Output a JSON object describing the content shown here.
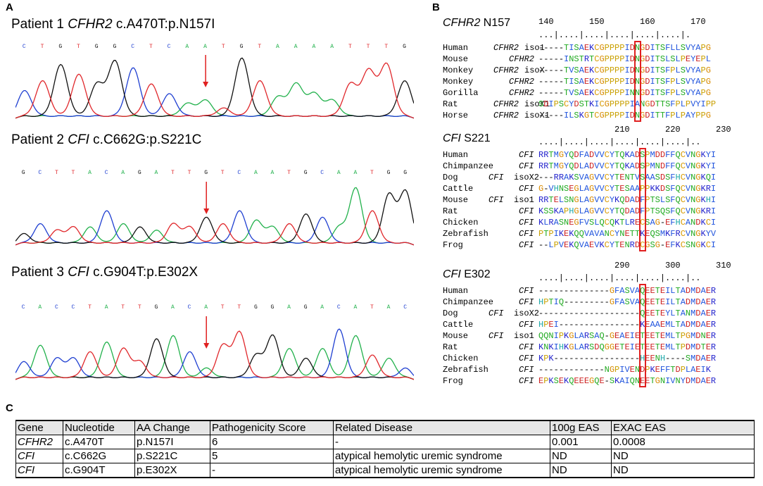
{
  "panel_a": {
    "letter": "A",
    "patients": [
      {
        "label": "Patient 1",
        "gene": "CFHR2",
        "variant": "c.A470T:p.N157I",
        "bases": [
          "C",
          "T",
          "G",
          "T",
          "G",
          "G",
          "C",
          "T",
          "C",
          "A",
          "A",
          "T",
          "G",
          "T",
          "A",
          "A",
          "A",
          "A",
          "T",
          "T",
          "T",
          "G"
        ]
      },
      {
        "label": "Patient 2",
        "gene": "CFI",
        "variant": "c.C662G:p.S221C",
        "bases": [
          "G",
          "C",
          "T",
          "T",
          "A",
          "C",
          "A",
          "G",
          "A",
          "T",
          "T",
          "G",
          "T",
          "C",
          "A",
          "A",
          "T",
          "G",
          "C",
          "A",
          "A",
          "T",
          "G",
          "G"
        ]
      },
      {
        "label": "Patient 3",
        "gene": "CFI",
        "variant": "c.G904T:p.E302X",
        "bases": [
          "C",
          "A",
          "C",
          "C",
          "T",
          "A",
          "T",
          "T",
          "G",
          "A",
          "C",
          "A",
          "T",
          "T",
          "G",
          "G",
          "A",
          "G",
          "A",
          "C",
          "A",
          "T",
          "A",
          "C"
        ]
      }
    ]
  },
  "panel_b": {
    "letter": "B",
    "blocks": [
      {
        "gene": "CFHR2",
        "site": "N157",
        "positions": [
          "140",
          "150",
          "160",
          "170"
        ],
        "ruler": "...|....|....|....|....|....|.",
        "rows": [
          {
            "species": "Human",
            "gene": "CFHR2",
            "iso": "iso1",
            "seq": "-----TISAEKCGPPPPIDNGDITSFLLSVYAPG"
          },
          {
            "species": "Mouse",
            "gene": "CFHR2",
            "iso": "",
            "seq": "-----INSTRTCGPPPPIDNGDITSLSLPEYEPL"
          },
          {
            "species": "Monkey",
            "gene": "CFHR2",
            "iso": "isoX",
            "seq": "-----TVSAEKCGPPPPIDNGDITSFPLSVYAPG"
          },
          {
            "species": "Monkey",
            "gene": "CFHR2",
            "iso": "",
            "seq": "-----TISAEKCGPPPPIDNGDITSFPLSVYAPG"
          },
          {
            "species": "Gorilla",
            "gene": "CFHR2",
            "iso": "",
            "seq": "-----TVSAEKCGPPPPINNGDITSFPLSVYAPG"
          },
          {
            "species": "Rat",
            "gene": "CFHR2",
            "iso": "isoX1",
            "seq": "SDIPSCYDSTKICGPPPPIANGDTTSFPLPVYIPP"
          },
          {
            "species": "Horse",
            "gene": "CFHR2",
            "iso": "isoX1",
            "seq": "-----ILSKGTCGPPPPIDNGDITTFPLPAYPPG"
          }
        ]
      },
      {
        "gene": "CFI",
        "site": "S221",
        "positions": [
          "210",
          "220",
          "230"
        ],
        "ruler": "....|....|....|....|....|....|..",
        "rows": [
          {
            "species": "Human",
            "gene": "CFI",
            "iso": "",
            "seq": "RRTMGYQDFADVVCYTQKADSPMDDFFQCVNGKYI"
          },
          {
            "species": "Chimpanzee",
            "gene": "CFI",
            "iso": "",
            "seq": "RRTMGYQDLADVVCYTQKADSPMNDFFQCVNGKYI"
          },
          {
            "species": "Dog",
            "gene": "CFI",
            "iso": "isoX2",
            "seq": "---RRAKSVAGVVCYTENTVSAASDSFHCVNGKQI"
          },
          {
            "species": "Cattle",
            "gene": "CFI",
            "iso": "",
            "seq": "G-VHNSEGLAGVVCYTESAAPPKKDSFQCVNGKRI"
          },
          {
            "species": "Mouse",
            "gene": "CFI",
            "iso": "iso1",
            "seq": "RRTELSNGLAGVVCYKQDADFPTSLSFQCVNGKHI"
          },
          {
            "species": "Rat",
            "gene": "CFI",
            "iso": "",
            "seq": "KSSKAPHGLAGVVCYTQDADFPTSQSFQCVNGKRI"
          },
          {
            "species": "Chicken",
            "gene": "CFI",
            "iso": "",
            "seq": "KLRASNEGFVSLQCQKTLRECSAG-EFHCANDKCI"
          },
          {
            "species": "Zebrafish",
            "gene": "CFI",
            "iso": "",
            "seq": "PTPIKEKQQVAVANCYNETTKEQSMKFRCVNGKYV"
          },
          {
            "species": "Frog",
            "gene": "CFI",
            "iso": "",
            "seq": "--LPVEKQVAEVKCYTENRDCGSG-EFKCSNGKCI"
          }
        ]
      },
      {
        "gene": "CFI",
        "site": "E302",
        "positions": [
          "290",
          "300",
          "310"
        ],
        "ruler": "....|....|....|....|....|....|..",
        "rows": [
          {
            "species": "Human",
            "gene": "CFI",
            "iso": "",
            "seq": "--------------GFASVAQEETEILTADMDAER"
          },
          {
            "species": "Chimpanzee",
            "gene": "CFI",
            "iso": "",
            "seq": "HPTIQ---------GFASVAQEETEILTADMDAER"
          },
          {
            "species": "Dog",
            "gene": "CFI",
            "iso": "isoX2",
            "seq": "--------------------QEETEYLTANMDAER"
          },
          {
            "species": "Cattle",
            "gene": "CFI",
            "iso": "",
            "seq": "HPEI----------------KEAAEMLTADMDAER"
          },
          {
            "species": "Mouse",
            "gene": "CFI",
            "iso": "iso1",
            "seq": "QQNIPKGLARSAQ-GEAEIETEETEMLTPGMDNER"
          },
          {
            "species": "Rat",
            "gene": "CFI",
            "iso": "",
            "seq": "KNKIHKGLARSDQGGETEIETEETEMLTPDMDTER"
          },
          {
            "species": "Chicken",
            "gene": "CFI",
            "iso": "",
            "seq": "KPK-----------------HEENH----SMDAER"
          },
          {
            "species": "Zebrafish",
            "gene": "CFI",
            "iso": "",
            "seq": "-------------NGPIVENDPKEFFTDPLAEIK"
          },
          {
            "species": "Frog",
            "gene": "CFI",
            "iso": "",
            "seq": "EPKSEKQEEEGQE-SKAIQNEETGNIVNYDMDAER"
          }
        ]
      }
    ]
  },
  "panel_c": {
    "letter": "C",
    "headers": [
      "Gene",
      "Nucleotide",
      "AA Change",
      "Pathogenicity Score",
      "Related Disease",
      "100g EAS",
      "EXAC EAS"
    ],
    "rows": [
      [
        "CFHR2",
        "c.A470T",
        "p.N157I",
        "6",
        "-",
        "0.001",
        "0.0008"
      ],
      [
        "CFI",
        "c.C662G",
        "p.S221C",
        "5",
        "atypical hemolytic uremic syndrome",
        "ND",
        "ND"
      ],
      [
        "CFI",
        "c.G904T",
        "p.E302X",
        "-",
        "atypical hemolytic uremic syndrome",
        "ND",
        "ND"
      ]
    ]
  },
  "colors": {
    "base_A": "#22b14c",
    "base_C": "#1f3fd1",
    "base_G": "#111111",
    "base_T": "#e0272b",
    "arrow": "#e02020",
    "highlight": "#e02020"
  }
}
